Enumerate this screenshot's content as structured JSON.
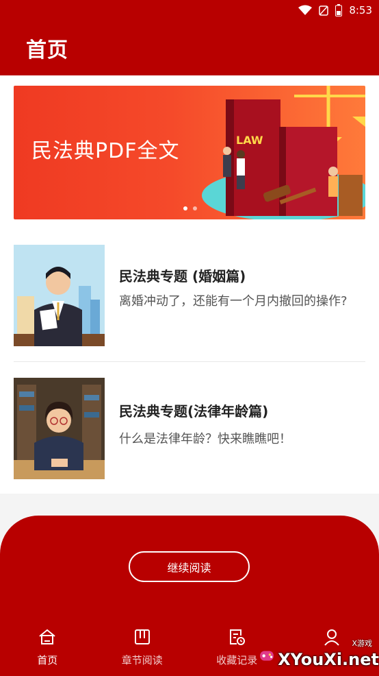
{
  "status_bar": {
    "time": "8:53"
  },
  "app_bar": {
    "title": "首页"
  },
  "banner": {
    "text": "民法典PDF全文",
    "book_label": "LAW"
  },
  "articles": [
    {
      "title": "民法典专题 (婚姻篇)",
      "desc": "离婚冲动了，还能有一个月内撤回的操作?"
    },
    {
      "title": "民法典专题(法律年龄篇)",
      "desc": "什么是法律年龄？快来瞧瞧吧！"
    }
  ],
  "continue_button": {
    "label": "继续阅读"
  },
  "nav": [
    {
      "label": "首页",
      "icon": "home-icon"
    },
    {
      "label": "章节阅读",
      "icon": "book-icon"
    },
    {
      "label": "收藏记录",
      "icon": "history-icon"
    },
    {
      "label": "",
      "icon": "user-icon"
    }
  ],
  "watermark": {
    "text": "XYouXi.net",
    "small": "X游戏"
  },
  "colors": {
    "primary": "#b80000",
    "banner_start": "#ef3a22",
    "banner_end": "#ff7a3a"
  }
}
